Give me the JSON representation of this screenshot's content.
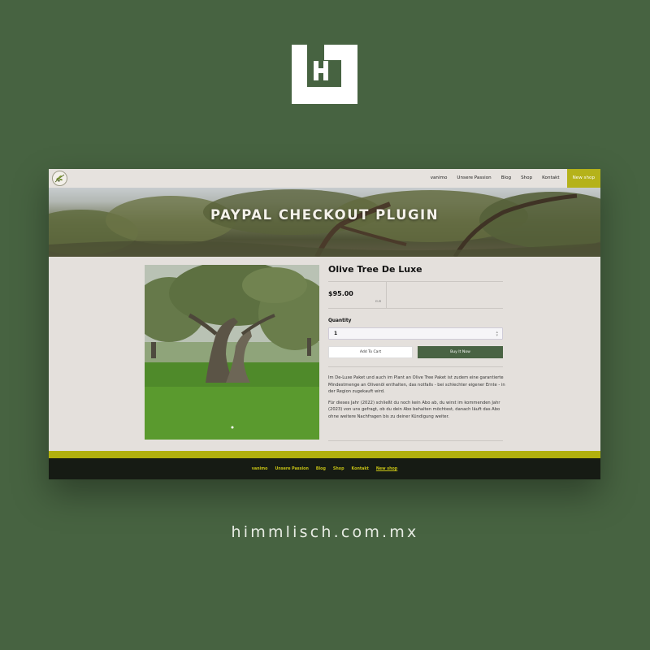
{
  "brand": {
    "logo_icon": "hh-monogram-icon",
    "background_color": "#476341",
    "url": "himmlisch.com.mx"
  },
  "site": {
    "logo_icon": "olive-branch-logo-icon",
    "nav": {
      "items": [
        "vanimo",
        "Unsere Passion",
        "Blog",
        "Shop",
        "Kontakt"
      ],
      "cta": "New shop",
      "cta_color": "#b5b21a"
    },
    "hero": {
      "title": "PAYPAL CHECKOUT PLUGIN"
    },
    "product": {
      "title": "Olive Tree De Luxe",
      "price": "$95.00",
      "currency": "EUR",
      "quantity_label": "Quantity",
      "quantity_value": "1",
      "add_to_cart": "Add To Cart",
      "buy_now": "Buy It Now",
      "buy_color": "#496343",
      "description": [
        "Im De-Luxe Paket und auch im Plant an Olive Tree Paket ist zudem eine garantierte Mindestmenge an Olivenöl enthalten, das notfalls - bei schlechter eigener Ernte - in der Region zugekauft wird.",
        "Für dieses Jahr (2022) schließt du noch kein Abo ab, du wirst im kommenden Jahr (2023) von uns gefragt, ob du dein Abo behalten möchtest, danach läuft das Abo ohne weitere Nachfragen bis zu deiner Kündigung weiter."
      ]
    },
    "footer": {
      "items": [
        "vanimo",
        "Unsere Passion",
        "Blog",
        "Shop",
        "Kontakt",
        "New shop"
      ],
      "accent_color": "#b2b00e"
    }
  }
}
